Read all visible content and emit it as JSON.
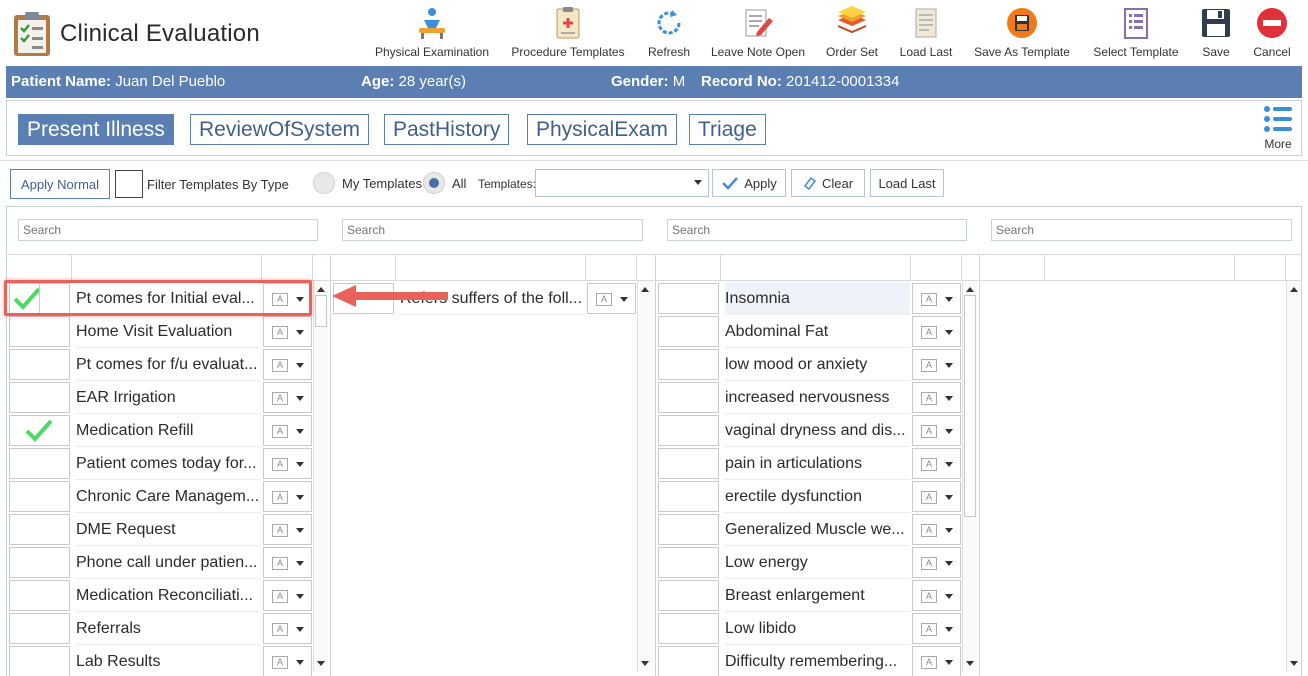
{
  "app": {
    "title": "Clinical Evaluation"
  },
  "toolbar": [
    {
      "label": "Physical Examination",
      "icon": "physical-exam-icon"
    },
    {
      "label": "Procedure Templates",
      "icon": "procedure-templates-icon"
    },
    {
      "label": "Refresh",
      "icon": "refresh-icon"
    },
    {
      "label": "Leave Note Open",
      "icon": "leave-note-open-icon"
    },
    {
      "label": "Order Set",
      "icon": "order-set-icon"
    },
    {
      "label": "Load Last",
      "icon": "load-last-icon"
    },
    {
      "label": "Save As Template",
      "icon": "save-as-template-icon"
    },
    {
      "label": "Select Template",
      "icon": "select-template-icon"
    },
    {
      "label": "Save",
      "icon": "save-icon"
    },
    {
      "label": "Cancel",
      "icon": "cancel-icon"
    }
  ],
  "patient": {
    "name_label": "Patient Name:",
    "name": "Juan Del Pueblo",
    "age_label": "Age:",
    "age": "28 year(s)",
    "gender_label": "Gender:",
    "gender": "M",
    "record_label": "Record No:",
    "record": "201412-0001334"
  },
  "tabs": [
    {
      "label": "Present Illness",
      "active": true
    },
    {
      "label": "ReviewOfSystem",
      "active": false
    },
    {
      "label": "PastHistory",
      "active": false
    },
    {
      "label": "PhysicalExam",
      "active": false
    },
    {
      "label": "Triage",
      "active": false
    }
  ],
  "more_label": "More",
  "filters": {
    "apply_normal": "Apply Normal",
    "filter_by_type": "Filter Templates By Type",
    "my_templates": "My Templates",
    "all": "All",
    "templates_label": "Templates:",
    "apply": "Apply",
    "clear": "Clear",
    "load_last": "Load Last"
  },
  "search_placeholder": "Search",
  "column1": [
    {
      "text": "Pt comes for Initial eval...",
      "checked": true
    },
    {
      "text": "Home Visit Evaluation",
      "checked": false
    },
    {
      "text": "Pt comes for f/u evaluat...",
      "checked": false
    },
    {
      "text": "EAR Irrigation",
      "checked": false
    },
    {
      "text": "Medication Refill",
      "checked": true
    },
    {
      "text": "Patient comes today for...",
      "checked": false
    },
    {
      "text": "Chronic Care Managem...",
      "checked": false
    },
    {
      "text": "DME Request",
      "checked": false
    },
    {
      "text": "Phone call under patien...",
      "checked": false
    },
    {
      "text": "Medication Reconciliati...",
      "checked": false
    },
    {
      "text": "Referrals",
      "checked": false
    },
    {
      "text": "Lab Results",
      "checked": false
    }
  ],
  "column2": [
    {
      "text": "Refers suffers of the foll..."
    }
  ],
  "column3": [
    {
      "text": "Insomnia"
    },
    {
      "text": "Abdominal Fat"
    },
    {
      "text": "low mood or anxiety"
    },
    {
      "text": "increased nervousness"
    },
    {
      "text": "vaginal dryness and dis..."
    },
    {
      "text": "pain in articulations"
    },
    {
      "text": "erectile dysfunction"
    },
    {
      "text": "Generalized Muscle we..."
    },
    {
      "text": "Low energy"
    },
    {
      "text": "Breast enlargement"
    },
    {
      "text": "Low libido"
    },
    {
      "text": "Difficulty remembering..."
    }
  ],
  "colors": {
    "accent": "#5b7fb3",
    "check": "#4cd964",
    "highlight": "#e8615a"
  }
}
